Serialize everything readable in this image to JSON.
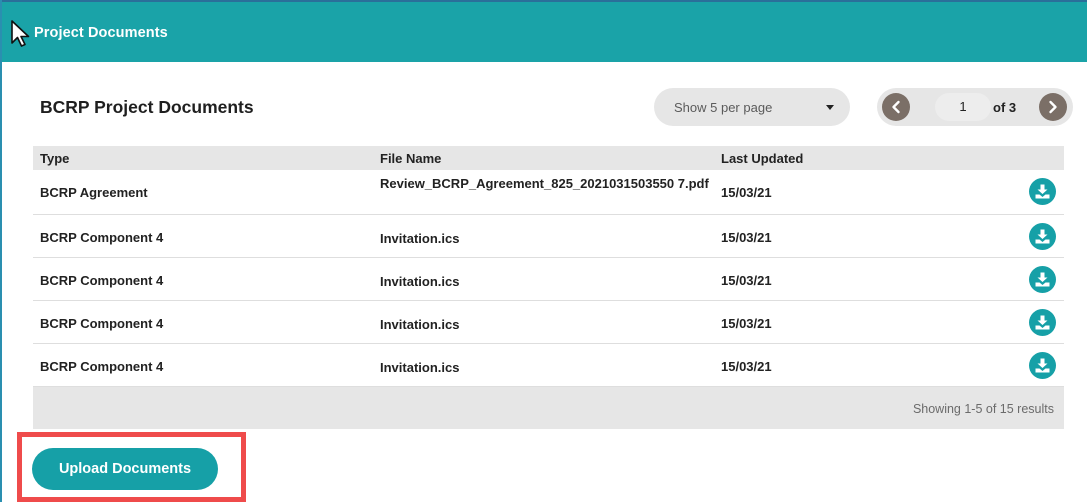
{
  "panel": {
    "title": "Project Documents"
  },
  "section": {
    "title": "BCRP Project Documents"
  },
  "per_page": {
    "selected": "Show 5 per page"
  },
  "pagination": {
    "current_page": "1",
    "of_label": "of 3"
  },
  "table": {
    "columns": [
      "Type",
      "File Name",
      "Last Updated"
    ],
    "rows": [
      {
        "type": "BCRP Agreement",
        "file": "Review_BCRP_Agreement_825_2021031503550 7.pdf",
        "date": "15/03/21"
      },
      {
        "type": "BCRP Component 4",
        "file": "Invitation.ics",
        "date": "15/03/21"
      },
      {
        "type": "BCRP Component 4",
        "file": "Invitation.ics",
        "date": "15/03/21"
      },
      {
        "type": "BCRP Component 4",
        "file": "Invitation.ics",
        "date": "15/03/21"
      },
      {
        "type": "BCRP Component 4",
        "file": "Invitation.ics",
        "date": "15/03/21"
      }
    ],
    "footer": "Showing 1-5 of 15 results"
  },
  "upload": {
    "label": "Upload Documents"
  },
  "colors": {
    "header": "#1aa3a8",
    "accent": "#16a0a7",
    "pager_button": "#7b6f67",
    "highlight": "#ef4b4b"
  },
  "icons": [
    "mouse-pointer-icon",
    "chevron-left-icon",
    "chevron-right-icon",
    "caret-down-icon",
    "download-icon"
  ]
}
